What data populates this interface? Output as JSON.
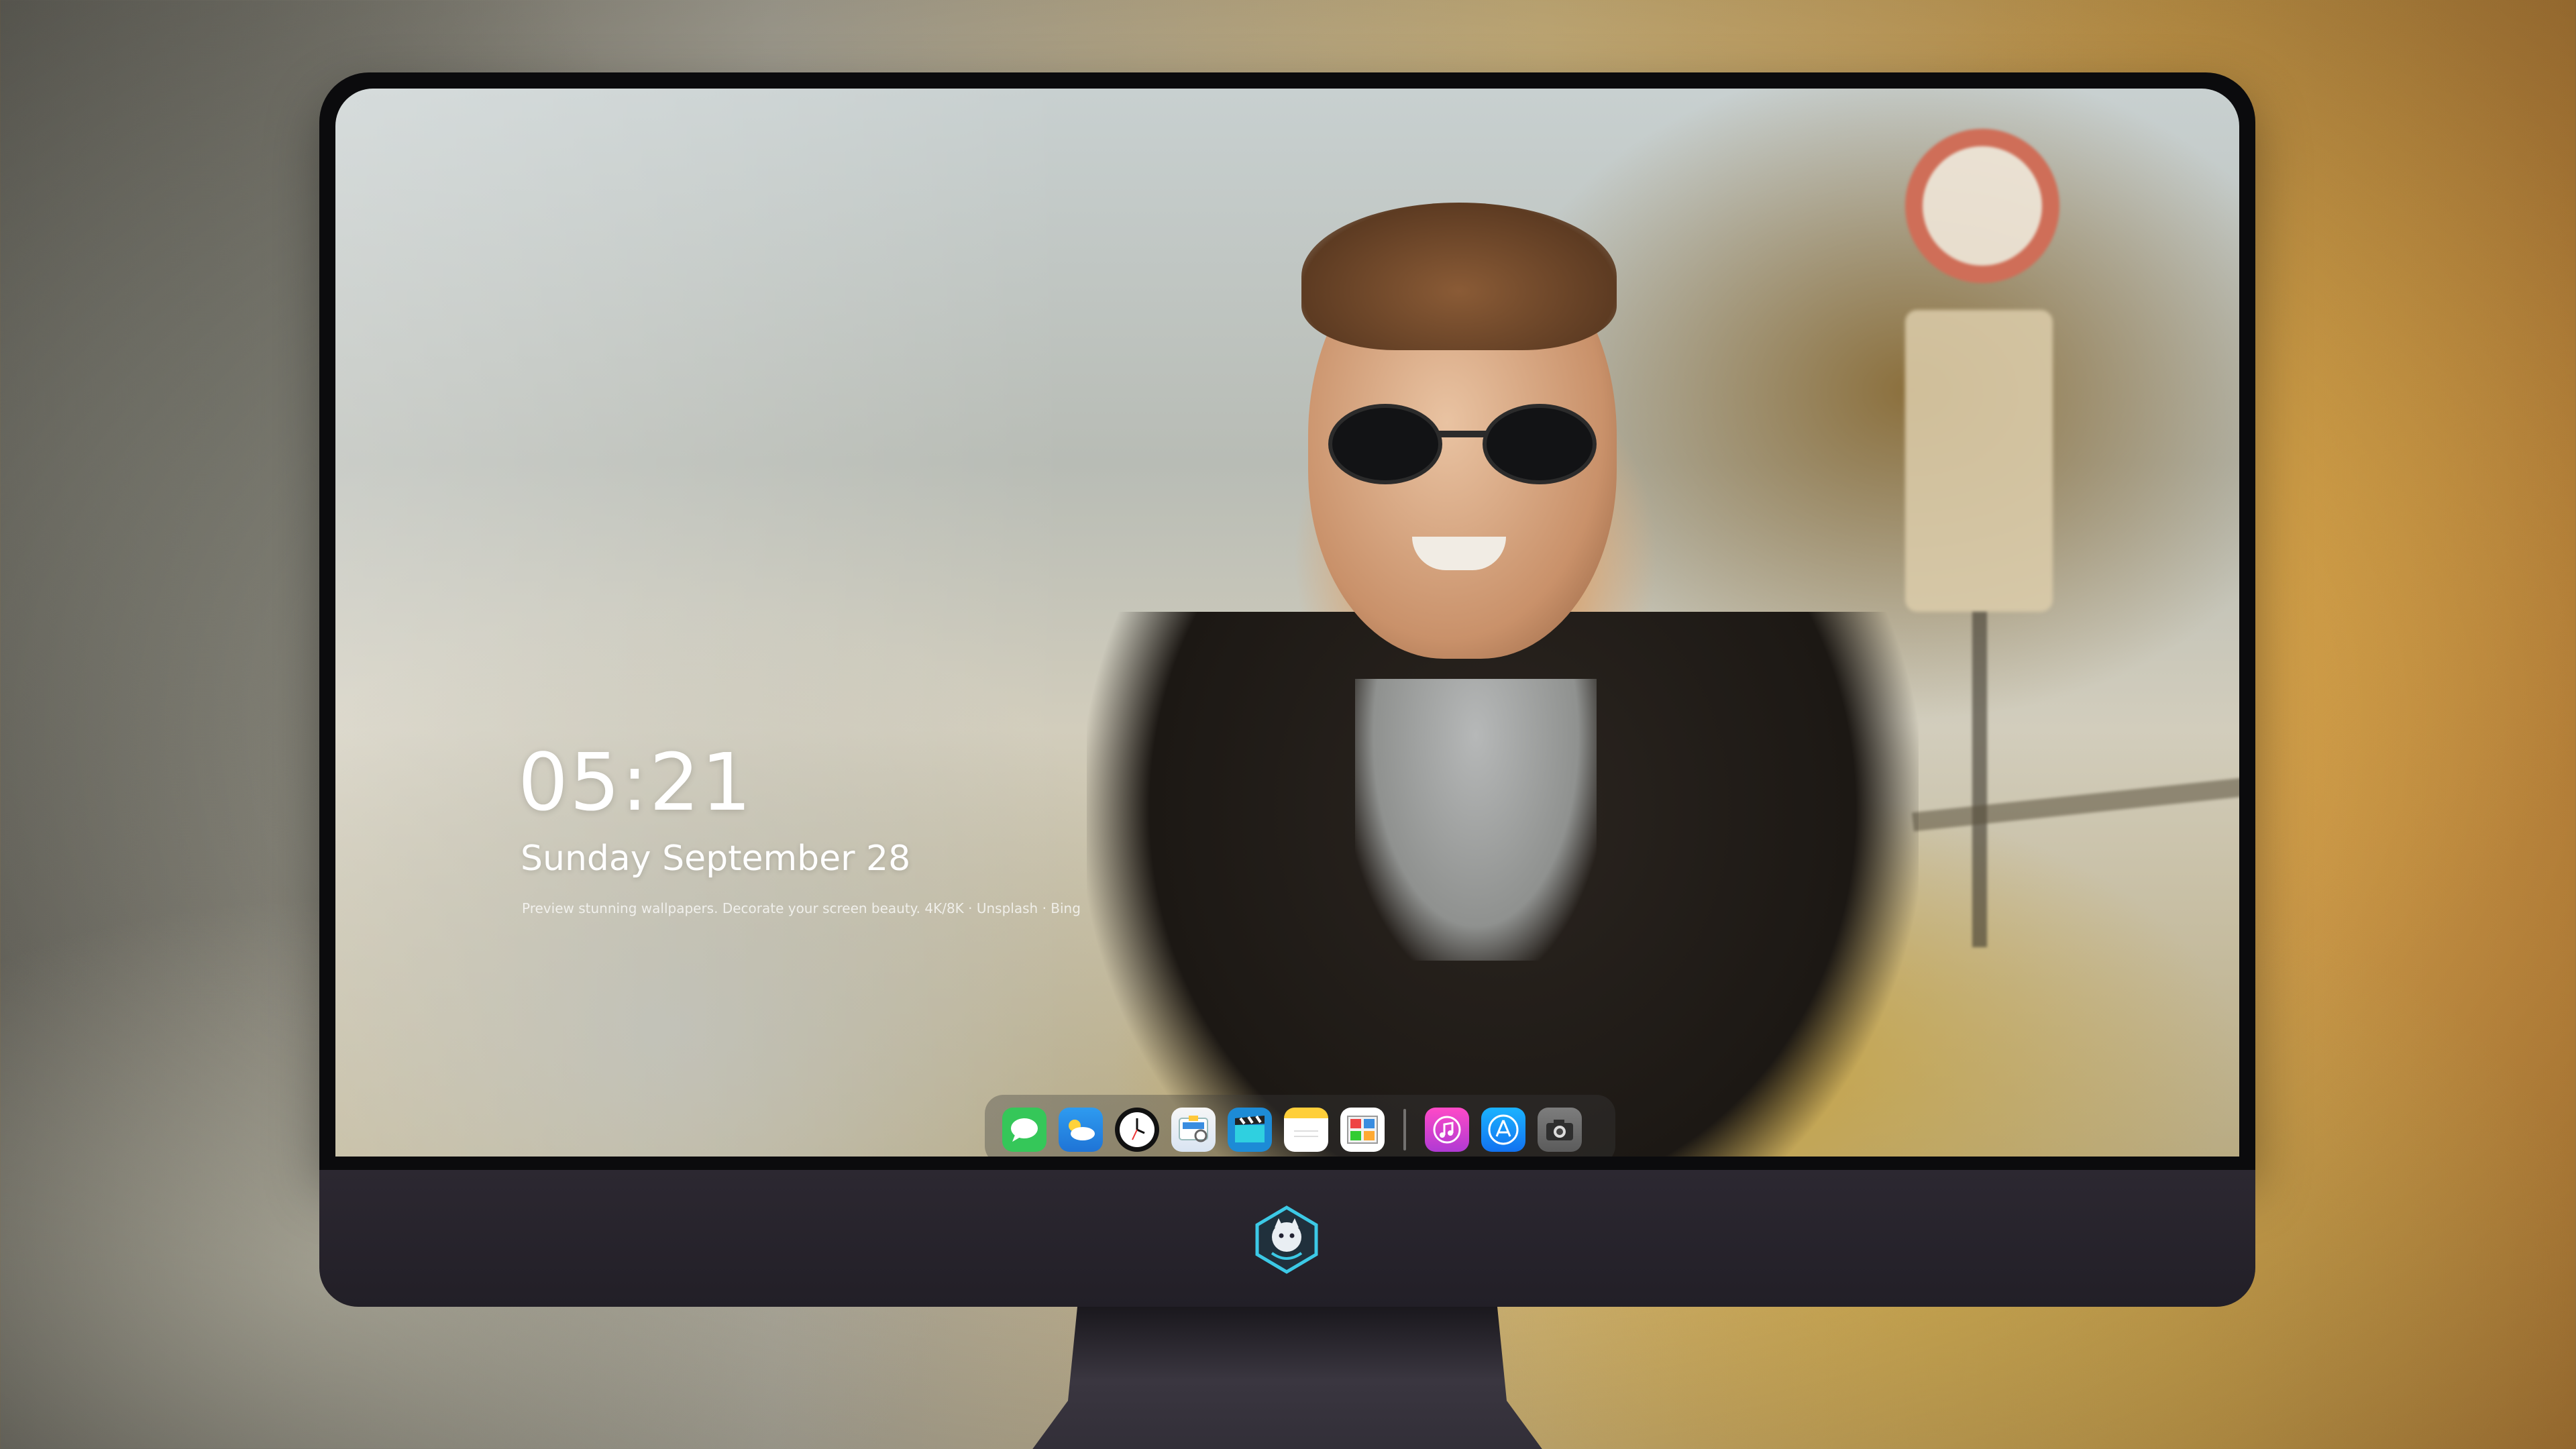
{
  "lockscreen": {
    "time": "05:21",
    "date": "Sunday September  28",
    "tagline": "Preview stunning wallpapers. Decorate your screen beauty. 4K/8K · Unsplash · Bing",
    "colors": {
      "text": "#ffffff"
    }
  },
  "dock": {
    "items": [
      {
        "name": "messages",
        "icon": "messages-icon"
      },
      {
        "name": "weather",
        "icon": "weather-icon"
      },
      {
        "name": "clock",
        "icon": "clock-icon"
      },
      {
        "name": "preview",
        "icon": "preview-icon"
      },
      {
        "name": "claquette",
        "icon": "clapperboard-icon"
      },
      {
        "name": "notes",
        "icon": "notes-icon"
      },
      {
        "name": "photo-slideshow",
        "icon": "photos-icon"
      },
      {
        "name": "music",
        "icon": "music-icon"
      },
      {
        "name": "app-store",
        "icon": "appstore-icon"
      },
      {
        "name": "screenshot",
        "icon": "camera-icon"
      }
    ]
  },
  "device": {
    "logo": "mascot-logo-icon",
    "colors": {
      "bezel": "#0b0b0d",
      "chin": "#2c2831",
      "stand": "#2a2730"
    }
  }
}
